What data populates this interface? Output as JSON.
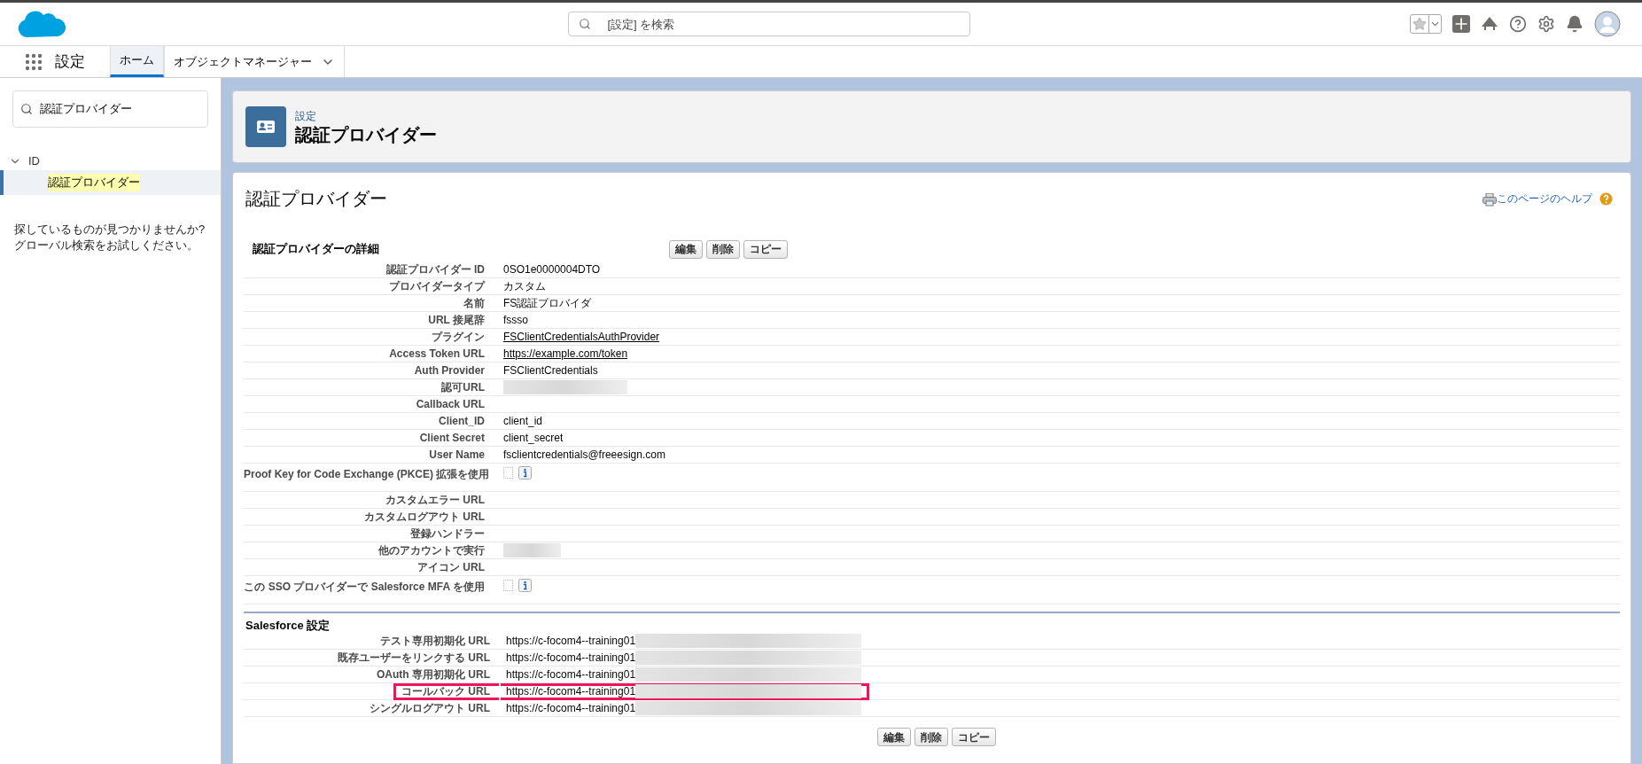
{
  "header": {
    "search_placeholder": "[設定] を検索"
  },
  "nav": {
    "app_name": "設定",
    "tabs": [
      {
        "label": "ホーム",
        "selected": true,
        "has_menu": false
      },
      {
        "label": "オブジェクトマネージャー",
        "selected": false,
        "has_menu": true
      }
    ]
  },
  "sidebar": {
    "search_value": "認証プロバイダー",
    "tree": [
      {
        "label": "ID",
        "expanded": true,
        "children": [
          {
            "label": "認証プロバイダー",
            "selected": true,
            "highlighted": true
          }
        ]
      }
    ],
    "help_text": "探しているものが見つかりませんか? グローバル検索をお試しください。"
  },
  "page_header": {
    "breadcrumb": "設定",
    "title": "認証プロバイダー"
  },
  "content": {
    "title": "認証プロバイダー",
    "help_link": "このページのヘルプ",
    "detail_section": {
      "title": "認証プロバイダーの詳細",
      "buttons": [
        "編集",
        "削除",
        "コピー"
      ],
      "rows": [
        {
          "label": "認証プロバイダー ID",
          "kind": "text",
          "value": "0SO1e0000004DTO"
        },
        {
          "label": "プロバイダータイプ",
          "kind": "text",
          "value": "カスタム"
        },
        {
          "label": "名前",
          "kind": "text",
          "value": "FS認証プロバイダ"
        },
        {
          "label": "URL 接尾辞",
          "kind": "text",
          "value": "fssso"
        },
        {
          "label": "プラグイン",
          "kind": "link",
          "value": "FSClientCredentialsAuthProvider"
        },
        {
          "label": "Access Token URL",
          "kind": "link",
          "value": "https://example.com/token"
        },
        {
          "label": "Auth Provider",
          "kind": "text",
          "value": "FSClientCredentials"
        },
        {
          "label": "認可URL",
          "kind": "redacted"
        },
        {
          "label": "Callback URL",
          "kind": "empty"
        },
        {
          "label": "Client_ID",
          "kind": "text",
          "value": "client_id"
        },
        {
          "label": "Client Secret",
          "kind": "text",
          "value": "client_secret"
        },
        {
          "label": "User Name",
          "kind": "text",
          "value": "fsclientcredentials@freeesign.com"
        },
        {
          "label": "Proof Key for Code Exchange (PKCE) 拡張を使用",
          "kind": "checkbox",
          "checked": false
        },
        {
          "label": "カスタムエラー URL",
          "kind": "empty"
        },
        {
          "label": "カスタムログアウト URL",
          "kind": "empty"
        },
        {
          "label": "登録ハンドラー",
          "kind": "empty"
        },
        {
          "label": "他のアカウントで実行",
          "kind": "redacted"
        },
        {
          "label": "アイコン URL",
          "kind": "empty"
        },
        {
          "label": "この SSO プロバイダーで Salesforce MFA を使用",
          "kind": "checkbox",
          "checked": false
        }
      ]
    },
    "salesforce_section": {
      "title": "Salesforce 設定",
      "rows": [
        {
          "label": "テスト専用初期化 URL",
          "value": "https://c-focom4--training01",
          "highlighted": false
        },
        {
          "label": "既存ユーザーをリンクする URL",
          "value": "https://c-focom4--training01",
          "highlighted": false
        },
        {
          "label": "OAuth 専用初期化 URL",
          "value": "https://c-focom4--training01",
          "highlighted": false
        },
        {
          "label": "コールバック URL",
          "value": "https://c-focom4--training01",
          "highlighted": true
        },
        {
          "label": "シングルログアウト URL",
          "value": "https://c-focom4--training01",
          "highlighted": false
        }
      ],
      "buttons": [
        "編集",
        "削除",
        "コピー"
      ]
    }
  }
}
